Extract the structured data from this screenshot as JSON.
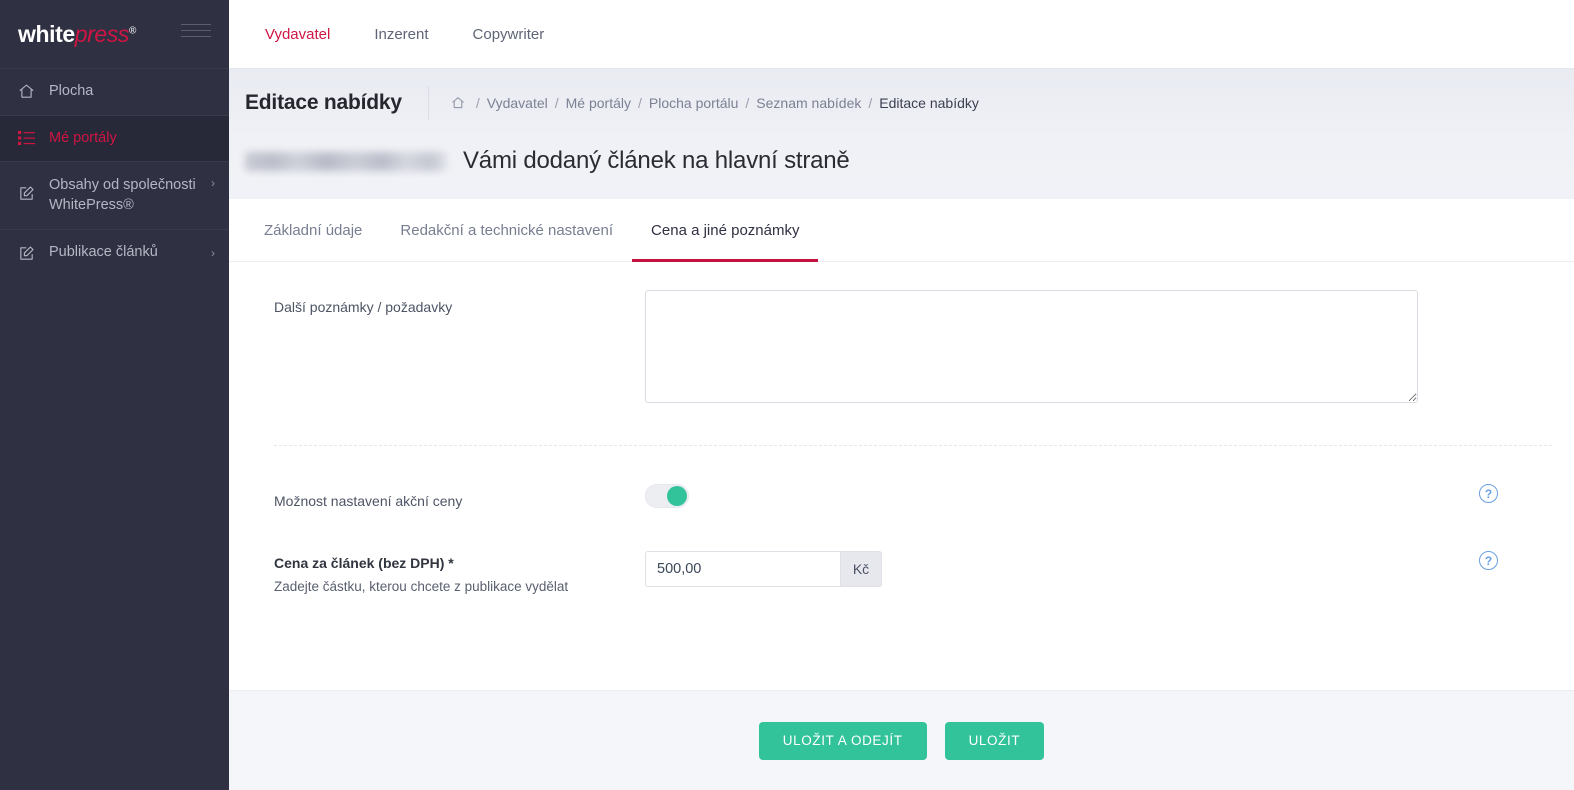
{
  "brand": {
    "part1": "white",
    "part2": "press",
    "reg": "®"
  },
  "sidebar": {
    "items": [
      {
        "label": "Plocha",
        "icon": "home-icon",
        "chevron": ""
      },
      {
        "label": "Mé portály",
        "icon": "list-icon",
        "chevron": ""
      },
      {
        "label": "Obsahy od společnosti WhitePress®",
        "icon": "edit-square-icon",
        "chevron": "›"
      },
      {
        "label": "Publikace článků",
        "icon": "edit-square-icon",
        "chevron": "›"
      }
    ]
  },
  "topbar": {
    "tabs": [
      {
        "label": "Vydavatel"
      },
      {
        "label": "Inzerent"
      },
      {
        "label": "Copywriter"
      }
    ]
  },
  "pagehead": {
    "title": "Editace nabídky",
    "breadcrumb": [
      {
        "label": "Vydavatel"
      },
      {
        "label": "Mé portály"
      },
      {
        "label": "Plocha portálu"
      },
      {
        "label": "Seznam nabídek"
      },
      {
        "label": "Editace nabídky"
      }
    ],
    "separator": "/",
    "offer_title": "Vámi dodaný článek na hlavní straně"
  },
  "tabs": [
    {
      "label": "Základní údaje"
    },
    {
      "label": "Redakční a technické nastavení"
    },
    {
      "label": "Cena a jiné poznámky"
    }
  ],
  "form": {
    "notes_label": "Další poznámky / požadavky",
    "notes_value": "",
    "notes_placeholder": "",
    "promo_label": "Možnost nastavení akční ceny",
    "promo_toggle_on": true,
    "price_label": "Cena za článek (bez DPH) *",
    "price_help": "Zadejte částku, kterou chcete z publikace vydělat",
    "price_value": "500,00",
    "price_currency": "Kč",
    "help_icon_glyph": "?"
  },
  "footer": {
    "save_and_exit_label": "ULOŽIT A ODEJÍT",
    "save_label": "ULOŽIT"
  },
  "colors": {
    "sidebar_bg": "#2f3142",
    "brand_accent": "#cf1543",
    "tab_underline": "#c4113f",
    "toggle_on": "#32c39a",
    "button_green": "#32c39a",
    "help_blue": "#6a9fe0"
  }
}
